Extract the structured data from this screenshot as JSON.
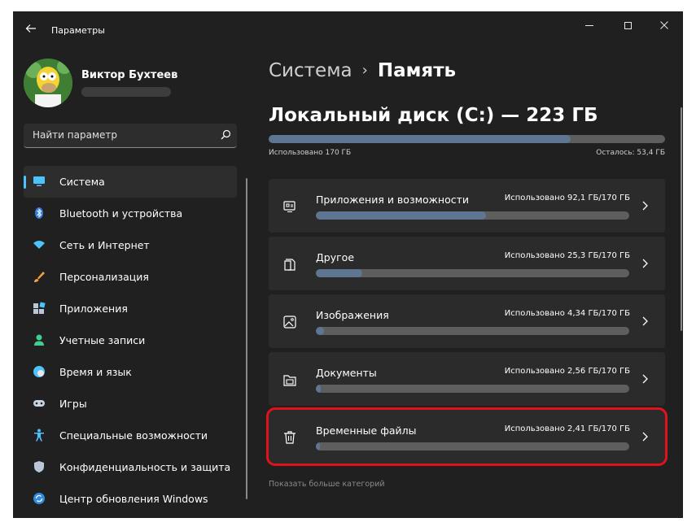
{
  "window": {
    "title": "Параметры",
    "back_icon": "arrow-left-icon",
    "controls": [
      "minimize",
      "maximize",
      "close"
    ]
  },
  "user": {
    "name": "Виктор Бухтеев",
    "avatar_icon": "homer-avatar"
  },
  "search": {
    "placeholder": "Найти параметр",
    "icon": "search-icon"
  },
  "sidebar": {
    "items": [
      {
        "label": "Система",
        "icon": "monitor-icon",
        "active": true
      },
      {
        "label": "Bluetooth и устройства",
        "icon": "bluetooth-icon",
        "active": false
      },
      {
        "label": "Сеть и Интернет",
        "icon": "wifi-icon",
        "active": false
      },
      {
        "label": "Персонализация",
        "icon": "brush-icon",
        "active": false
      },
      {
        "label": "Приложения",
        "icon": "apps-icon",
        "active": false
      },
      {
        "label": "Учетные записи",
        "icon": "person-icon",
        "active": false
      },
      {
        "label": "Время и язык",
        "icon": "globe-clock-icon",
        "active": false
      },
      {
        "label": "Игры",
        "icon": "gamepad-icon",
        "active": false
      },
      {
        "label": "Специальные возможности",
        "icon": "accessibility-icon",
        "active": false
      },
      {
        "label": "Конфиденциальность и защита",
        "icon": "shield-icon",
        "active": false
      },
      {
        "label": "Центр обновления Windows",
        "icon": "update-icon",
        "active": false
      }
    ]
  },
  "breadcrumb": {
    "parent": "Система",
    "separator": "›",
    "current": "Память"
  },
  "disk": {
    "title": "Локальный диск (C:) — 223 ГБ",
    "used_label": "Использовано 170 ГБ",
    "free_label": "Осталось: 53,4 ГБ",
    "used_fraction": 0.762
  },
  "categories": [
    {
      "label": "Приложения и возможности",
      "usage": "Использовано 92,1 ГБ/170 ГБ",
      "icon": "apps-list-icon",
      "fraction": 0.542,
      "highlighted": false
    },
    {
      "label": "Другое",
      "usage": "Использовано 25,3 ГБ/170 ГБ",
      "icon": "documents-icon",
      "fraction": 0.149,
      "highlighted": false
    },
    {
      "label": "Изображения",
      "usage": "Использовано 4,34 ГБ/170 ГБ",
      "icon": "image-icon",
      "fraction": 0.026,
      "highlighted": false
    },
    {
      "label": "Документы",
      "usage": "Использовано 2,56 ГБ/170 ГБ",
      "icon": "folder-icon",
      "fraction": 0.015,
      "highlighted": false
    },
    {
      "label": "Временные файлы",
      "usage": "Использовано 2,41 ГБ/170 ГБ",
      "icon": "trash-icon",
      "fraction": 0.014,
      "highlighted": true
    }
  ],
  "more_link": "Показать больше категорий",
  "colors": {
    "window_bg": "#202020",
    "card_bg": "#2b2b2b",
    "bar_track": "#5e5e5e",
    "bar_fill": "#5f7693",
    "accent": "#4cc2ff",
    "highlight": "#e0121b"
  }
}
